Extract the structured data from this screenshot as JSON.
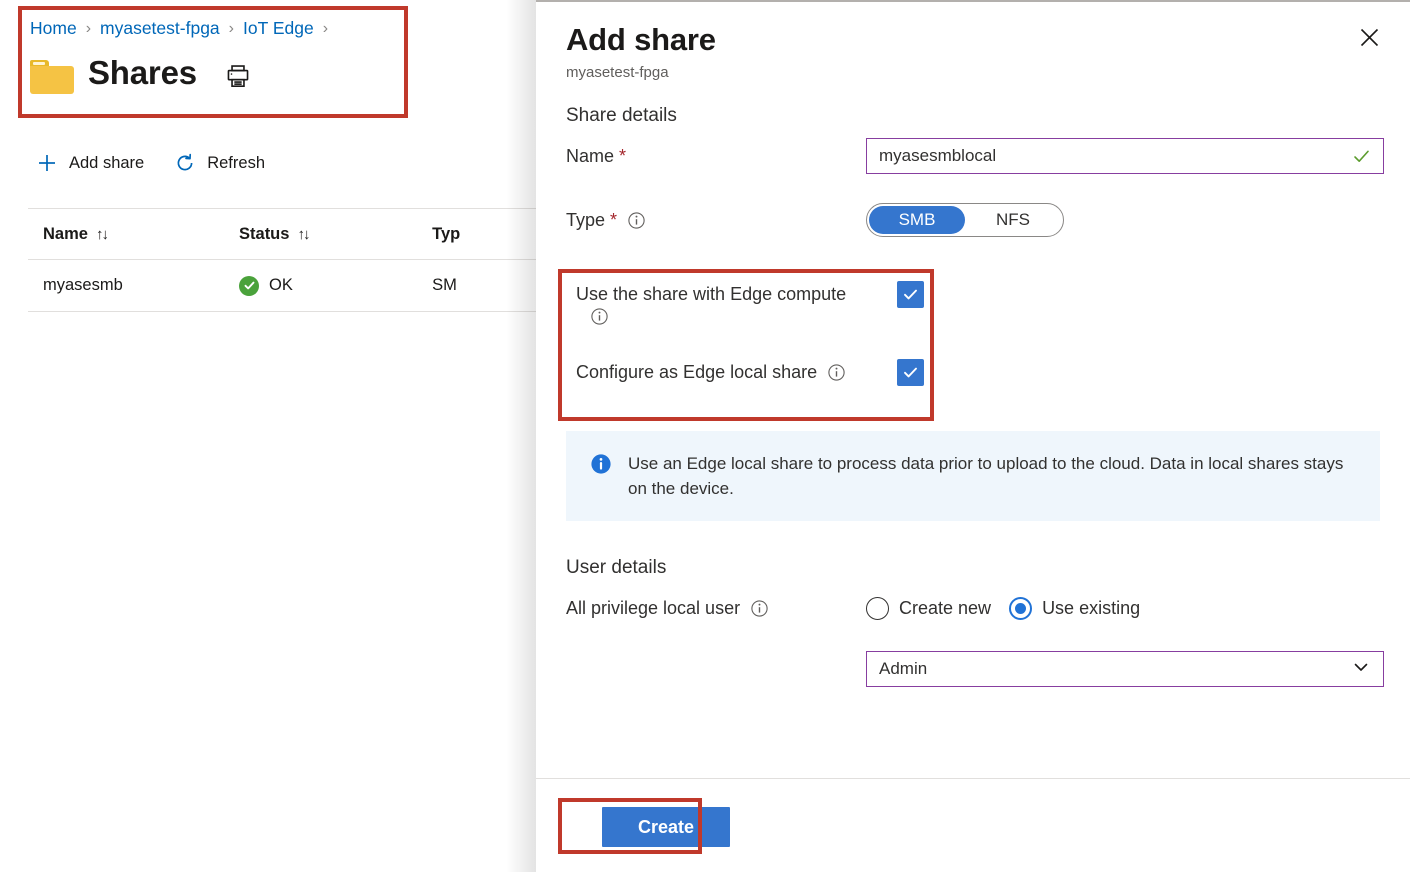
{
  "left": {
    "breadcrumb": {
      "name": "breadcrumb",
      "items": [
        "Home",
        "myasetest-fpga",
        "IoT Edge"
      ],
      "separator": "›",
      "trailing_separator": "›"
    },
    "page_title": "Shares",
    "folder_icon": "folder-icon",
    "print_icon": "print-icon",
    "toolbar": {
      "add_share": "Add share",
      "add_icon": "plus-icon",
      "refresh": "Refresh",
      "refresh_icon": "refresh-icon"
    },
    "table": {
      "columns": [
        {
          "label": "Name",
          "sort": "↑↓"
        },
        {
          "label": "Status",
          "sort": "↑↓"
        },
        {
          "label": "Typ",
          "sort": ""
        }
      ],
      "rows": [
        {
          "name": "myasesmb",
          "status": "OK",
          "status_icon": "check-circle-icon",
          "type": "SM"
        }
      ]
    }
  },
  "panel": {
    "title": "Add share",
    "subtitle": "myasetest-fpga",
    "close_icon": "close-icon",
    "share_details": {
      "section_title": "Share details",
      "name_label": "Name",
      "name_required": "*",
      "name_value": "myasesmblocal",
      "name_valid_icon": "check-icon",
      "type_label": "Type",
      "type_required": "*",
      "type_info_icon": "info-icon",
      "type_options": [
        "SMB",
        "NFS"
      ],
      "type_selected": "SMB"
    },
    "checkboxes": [
      {
        "label": "Use the share with Edge compute",
        "info_icon": "info-icon",
        "info_position": "below",
        "checked": true
      },
      {
        "label": "Configure as Edge local share",
        "info_icon": "info-icon",
        "info_position": "inline",
        "checked": true
      }
    ],
    "info_banner": {
      "icon": "info-filled-icon",
      "text": "Use an Edge local share to process data prior to upload to the cloud. Data in local shares stays on the device."
    },
    "user_details": {
      "section_title": "User details",
      "field_label": "All privilege local user",
      "info_icon": "info-icon",
      "radio_options": [
        "Create new",
        "Use existing"
      ],
      "radio_selected": "Use existing",
      "select_value": "Admin",
      "select_chevron": "chevron-down-icon"
    },
    "footer": {
      "create_label": "Create"
    }
  },
  "annotations": {
    "color": "#c0392b",
    "boxes": [
      "header-annotation",
      "checkboxes-annotation",
      "create-button-annotation"
    ]
  },
  "colors": {
    "link": "#0067b8",
    "accent_blue": "#3576ce",
    "radio_blue": "#2072d6",
    "input_border_purple": "#873ea0",
    "required_red": "#a4262c",
    "status_green": "#4aa23b",
    "check_green": "#5c9c2e",
    "banner_bg": "#eff6fc",
    "annotation_red": "#c0392b",
    "folder_yellow": "#f5c344"
  }
}
